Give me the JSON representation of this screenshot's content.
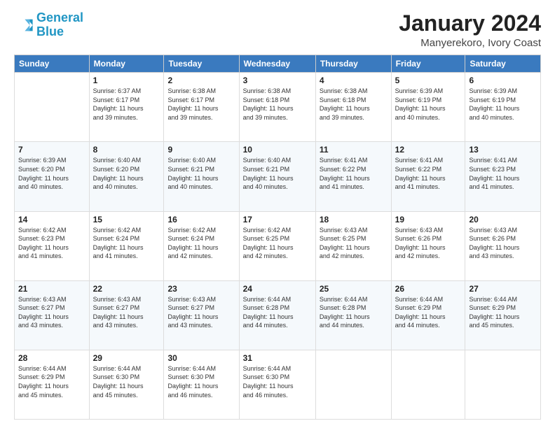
{
  "logo": {
    "line1": "General",
    "line2": "Blue"
  },
  "header": {
    "month": "January 2024",
    "location": "Manyerekoro, Ivory Coast"
  },
  "days_of_week": [
    "Sunday",
    "Monday",
    "Tuesday",
    "Wednesday",
    "Thursday",
    "Friday",
    "Saturday"
  ],
  "weeks": [
    [
      {
        "day": "",
        "info": ""
      },
      {
        "day": "1",
        "info": "Sunrise: 6:37 AM\nSunset: 6:17 PM\nDaylight: 11 hours\nand 39 minutes."
      },
      {
        "day": "2",
        "info": "Sunrise: 6:38 AM\nSunset: 6:17 PM\nDaylight: 11 hours\nand 39 minutes."
      },
      {
        "day": "3",
        "info": "Sunrise: 6:38 AM\nSunset: 6:18 PM\nDaylight: 11 hours\nand 39 minutes."
      },
      {
        "day": "4",
        "info": "Sunrise: 6:38 AM\nSunset: 6:18 PM\nDaylight: 11 hours\nand 39 minutes."
      },
      {
        "day": "5",
        "info": "Sunrise: 6:39 AM\nSunset: 6:19 PM\nDaylight: 11 hours\nand 40 minutes."
      },
      {
        "day": "6",
        "info": "Sunrise: 6:39 AM\nSunset: 6:19 PM\nDaylight: 11 hours\nand 40 minutes."
      }
    ],
    [
      {
        "day": "7",
        "info": "Sunrise: 6:39 AM\nSunset: 6:20 PM\nDaylight: 11 hours\nand 40 minutes."
      },
      {
        "day": "8",
        "info": "Sunrise: 6:40 AM\nSunset: 6:20 PM\nDaylight: 11 hours\nand 40 minutes."
      },
      {
        "day": "9",
        "info": "Sunrise: 6:40 AM\nSunset: 6:21 PM\nDaylight: 11 hours\nand 40 minutes."
      },
      {
        "day": "10",
        "info": "Sunrise: 6:40 AM\nSunset: 6:21 PM\nDaylight: 11 hours\nand 40 minutes."
      },
      {
        "day": "11",
        "info": "Sunrise: 6:41 AM\nSunset: 6:22 PM\nDaylight: 11 hours\nand 41 minutes."
      },
      {
        "day": "12",
        "info": "Sunrise: 6:41 AM\nSunset: 6:22 PM\nDaylight: 11 hours\nand 41 minutes."
      },
      {
        "day": "13",
        "info": "Sunrise: 6:41 AM\nSunset: 6:23 PM\nDaylight: 11 hours\nand 41 minutes."
      }
    ],
    [
      {
        "day": "14",
        "info": "Sunrise: 6:42 AM\nSunset: 6:23 PM\nDaylight: 11 hours\nand 41 minutes."
      },
      {
        "day": "15",
        "info": "Sunrise: 6:42 AM\nSunset: 6:24 PM\nDaylight: 11 hours\nand 41 minutes."
      },
      {
        "day": "16",
        "info": "Sunrise: 6:42 AM\nSunset: 6:24 PM\nDaylight: 11 hours\nand 42 minutes."
      },
      {
        "day": "17",
        "info": "Sunrise: 6:42 AM\nSunset: 6:25 PM\nDaylight: 11 hours\nand 42 minutes."
      },
      {
        "day": "18",
        "info": "Sunrise: 6:43 AM\nSunset: 6:25 PM\nDaylight: 11 hours\nand 42 minutes."
      },
      {
        "day": "19",
        "info": "Sunrise: 6:43 AM\nSunset: 6:26 PM\nDaylight: 11 hours\nand 42 minutes."
      },
      {
        "day": "20",
        "info": "Sunrise: 6:43 AM\nSunset: 6:26 PM\nDaylight: 11 hours\nand 43 minutes."
      }
    ],
    [
      {
        "day": "21",
        "info": "Sunrise: 6:43 AM\nSunset: 6:27 PM\nDaylight: 11 hours\nand 43 minutes."
      },
      {
        "day": "22",
        "info": "Sunrise: 6:43 AM\nSunset: 6:27 PM\nDaylight: 11 hours\nand 43 minutes."
      },
      {
        "day": "23",
        "info": "Sunrise: 6:43 AM\nSunset: 6:27 PM\nDaylight: 11 hours\nand 43 minutes."
      },
      {
        "day": "24",
        "info": "Sunrise: 6:44 AM\nSunset: 6:28 PM\nDaylight: 11 hours\nand 44 minutes."
      },
      {
        "day": "25",
        "info": "Sunrise: 6:44 AM\nSunset: 6:28 PM\nDaylight: 11 hours\nand 44 minutes."
      },
      {
        "day": "26",
        "info": "Sunrise: 6:44 AM\nSunset: 6:29 PM\nDaylight: 11 hours\nand 44 minutes."
      },
      {
        "day": "27",
        "info": "Sunrise: 6:44 AM\nSunset: 6:29 PM\nDaylight: 11 hours\nand 45 minutes."
      }
    ],
    [
      {
        "day": "28",
        "info": "Sunrise: 6:44 AM\nSunset: 6:29 PM\nDaylight: 11 hours\nand 45 minutes."
      },
      {
        "day": "29",
        "info": "Sunrise: 6:44 AM\nSunset: 6:30 PM\nDaylight: 11 hours\nand 45 minutes."
      },
      {
        "day": "30",
        "info": "Sunrise: 6:44 AM\nSunset: 6:30 PM\nDaylight: 11 hours\nand 46 minutes."
      },
      {
        "day": "31",
        "info": "Sunrise: 6:44 AM\nSunset: 6:30 PM\nDaylight: 11 hours\nand 46 minutes."
      },
      {
        "day": "",
        "info": ""
      },
      {
        "day": "",
        "info": ""
      },
      {
        "day": "",
        "info": ""
      }
    ]
  ]
}
